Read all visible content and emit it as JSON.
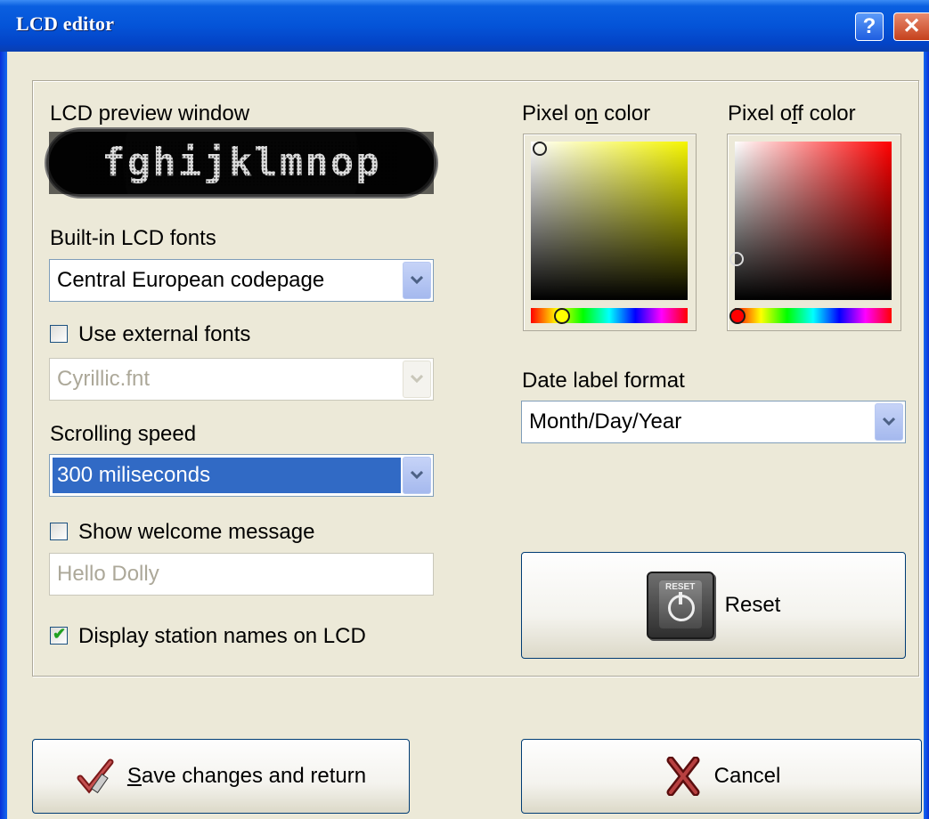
{
  "window": {
    "title": "LCD editor",
    "help_label": "?",
    "close_label": "✕"
  },
  "lcd_preview": {
    "label": "LCD preview window",
    "display_text": "fghijklmnop"
  },
  "builtin_fonts": {
    "label": "Built-in LCD fonts",
    "value": "Central European codepage"
  },
  "external_fonts": {
    "checkbox_label": "Use external fonts",
    "checked": false,
    "value": "Cyrillic.fnt"
  },
  "scrolling_speed": {
    "label": "Scrolling speed",
    "value": "300 miliseconds"
  },
  "welcome": {
    "checkbox_label": "Show welcome message",
    "checked": false,
    "value": "Hello Dolly"
  },
  "station_names": {
    "checkbox_label": "Display station names on LCD",
    "checked": true
  },
  "pixel_on": {
    "label_pre": "Pixel o",
    "label_u": "n",
    "label_post": " color",
    "base_color": "#f5f500"
  },
  "pixel_off": {
    "label_pre": "Pixel o",
    "label_u": "f",
    "label_post": "f color",
    "base_color": "#ff0000"
  },
  "date_format": {
    "label": "Date label format",
    "value": "Month/Day/Year"
  },
  "reset": {
    "label": "Reset",
    "icon_text": "RESET"
  },
  "save": {
    "label_u": "S",
    "label_rest": "ave changes and return"
  },
  "cancel": {
    "label": "Cancel"
  }
}
